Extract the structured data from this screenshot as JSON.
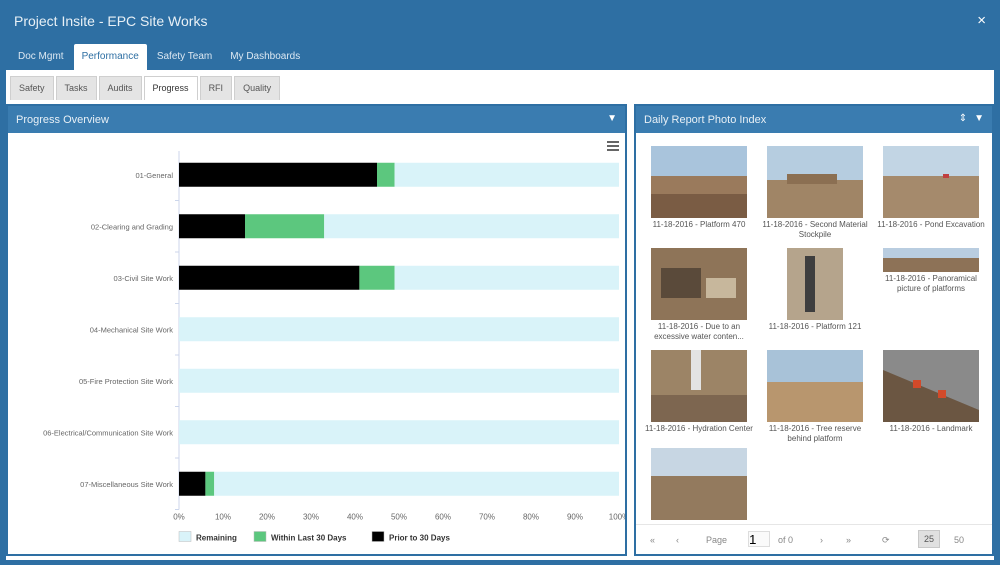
{
  "window": {
    "title": "Project Insite - EPC Site Works",
    "close_label": "×"
  },
  "main_tabs": [
    "Doc Mgmt",
    "Performance",
    "Safety Team",
    "My Dashboards"
  ],
  "sub_tabs": [
    "Safety",
    "Tasks",
    "Audits",
    "Progress",
    "RFI",
    "Quality"
  ],
  "progress_panel": {
    "title": "Progress Overview"
  },
  "photo_panel": {
    "title": "Daily Report Photo Index"
  },
  "chart_data": {
    "type": "bar",
    "stacked": true,
    "orientation": "horizontal",
    "categories": [
      "01-General",
      "02-Clearing and Grading",
      "03-Civil Site Work",
      "04-Mechanical Site Work",
      "05-Fire Protection Site Work",
      "06-Electrical/Communication Site Work",
      "07-Miscellaneous Site Work"
    ],
    "series": [
      {
        "name": "Prior to 30 Days",
        "values": [
          45,
          15,
          41,
          0,
          0,
          0,
          6
        ],
        "color": "#000000"
      },
      {
        "name": "Within Last 30 Days",
        "values": [
          4,
          18,
          8,
          0,
          0,
          0,
          2
        ],
        "color": "#5cc77e"
      },
      {
        "name": "Remaining",
        "values": [
          51,
          67,
          51,
          100,
          100,
          100,
          92
        ],
        "color": "#d9f3f9"
      }
    ],
    "xlim": [
      0,
      100
    ],
    "x_ticks": [
      "0%",
      "10%",
      "20%",
      "30%",
      "40%",
      "50%",
      "60%",
      "70%",
      "80%",
      "90%",
      "100%"
    ],
    "legend_order": [
      "Remaining",
      "Within Last 30 Days",
      "Prior to 30 Days"
    ],
    "legend_position": "bottom",
    "grid": false
  },
  "photos": [
    {
      "caption": "11-18-2016 - Platform 470"
    },
    {
      "caption": "11-18-2016 - Second Material Stockpile"
    },
    {
      "caption": "11-18-2016 - Pond Excavation"
    },
    {
      "caption": "11-18-2016 - Due to an excessive water conten..."
    },
    {
      "caption": "11-18-2016 - Platform 121"
    },
    {
      "caption": "11-18-2016 - Panoramical picture of platforms"
    },
    {
      "caption": "11-18-2016 - Hydration Center"
    },
    {
      "caption": "11-18-2016 - Tree reserve behind platform"
    },
    {
      "caption": "11-18-2016 - Landmark"
    },
    {
      "caption": ""
    }
  ],
  "pager": {
    "page_label": "Page",
    "page_value": "1",
    "of_label": "of 0",
    "page_size": "25",
    "page_size_alt": "50"
  }
}
